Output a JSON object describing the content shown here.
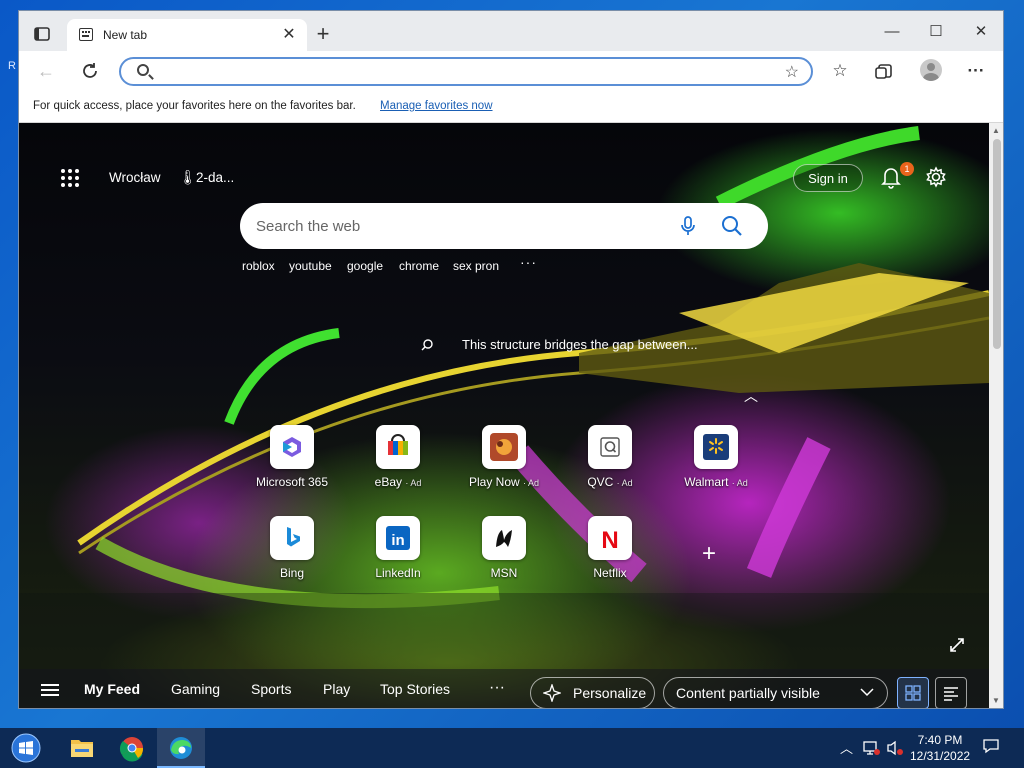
{
  "window": {
    "tab_title": "New tab",
    "address_value": "",
    "favbar_message": "For quick access, place your favorites here on the favorites bar.",
    "favbar_link": "Manage favorites now"
  },
  "newtab": {
    "weather_city": "Wrocław",
    "weather_forecast": "2-da...",
    "sign_in": "Sign in",
    "notification_count": "1",
    "search_placeholder": "Search the web",
    "trending": [
      "roblox",
      "youtube",
      "google",
      "chrome",
      "sex pron"
    ],
    "image_caption": "This structure bridges the gap between...",
    "tiles": [
      {
        "label": "Microsoft 365",
        "ad": ""
      },
      {
        "label": "eBay",
        "ad": "· Ad"
      },
      {
        "label": "Play Now",
        "ad": "· Ad"
      },
      {
        "label": "QVC",
        "ad": "· Ad"
      },
      {
        "label": "Walmart",
        "ad": "· Ad"
      },
      {
        "label": "Bing",
        "ad": ""
      },
      {
        "label": "LinkedIn",
        "ad": ""
      },
      {
        "label": "MSN",
        "ad": ""
      },
      {
        "label": "Netflix",
        "ad": ""
      }
    ],
    "feed_tabs": [
      "My Feed",
      "Gaming",
      "Sports",
      "Play",
      "Top Stories"
    ],
    "personalize": "Personalize",
    "content_visibility": "Content partially visible"
  },
  "taskbar": {
    "time": "7:40 PM",
    "date": "12/31/2022"
  },
  "colors": {
    "accent": "#1a5fb4",
    "taskbar": "#0d2a55",
    "badge": "#e9641c",
    "netflix": "#e50914",
    "linkedin": "#0a66c2"
  },
  "icons": [
    "tab-actions-icon",
    "back-icon",
    "refresh-icon",
    "search-icon",
    "favorite-add-icon",
    "favorites-icon",
    "collections-icon",
    "profile-icon",
    "more-icon",
    "apps-grid-icon",
    "thermometer-icon",
    "bell-icon",
    "gear-icon",
    "mic-icon",
    "expand-icon",
    "hamburger-icon",
    "sparkle-icon",
    "chevron-down-icon",
    "grid-view-icon",
    "list-view-icon",
    "windows-start-icon",
    "file-explorer-icon",
    "chrome-icon",
    "edge-icon",
    "network-icon",
    "volume-muted-icon",
    "notification-icon"
  ]
}
